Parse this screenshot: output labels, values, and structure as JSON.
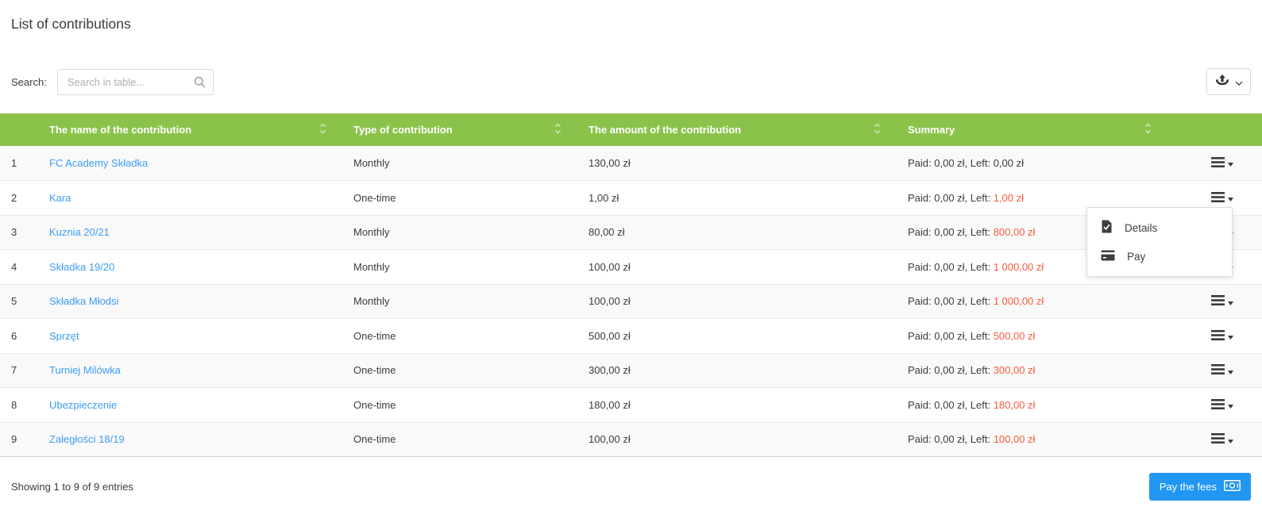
{
  "page_title": "List of contributions",
  "toolbar": {
    "search_label": "Search:",
    "search_placeholder": "Search in table...",
    "export_icon": "export-upload-icon"
  },
  "table": {
    "headers": [
      {
        "label": "The name of the contribution"
      },
      {
        "label": "Type of contribution"
      },
      {
        "label": "The amount of the contribution"
      },
      {
        "label": "Summary"
      }
    ],
    "rows": [
      {
        "index": "1",
        "name": "FC Academy Składka",
        "type": "Monthly",
        "amount": "130,00 zł",
        "summary_prefix": "Paid: 0,00 zł, Left:",
        "summary_left": "0,00 zł",
        "overdue": false
      },
      {
        "index": "2",
        "name": "Kara",
        "type": "One-time",
        "amount": "1,00 zł",
        "summary_prefix": "Paid: 0,00 zł, Left:",
        "summary_left": "1,00 zł",
        "overdue": true
      },
      {
        "index": "3",
        "name": "Kuznia 20/21",
        "type": "Monthly",
        "amount": "80,00 zł",
        "summary_prefix": "Paid: 0,00 zł, Left:",
        "summary_left": "800,00 zł",
        "overdue": true
      },
      {
        "index": "4",
        "name": "Składka 19/20",
        "type": "Monthly",
        "amount": "100,00 zł",
        "summary_prefix": "Paid: 0,00 zł, Left:",
        "summary_left": "1 000,00 zł",
        "overdue": true
      },
      {
        "index": "5",
        "name": "Składka Młodsi",
        "type": "Monthly",
        "amount": "100,00 zł",
        "summary_prefix": "Paid: 0,00 zł, Left:",
        "summary_left": "1 000,00 zł",
        "overdue": true
      },
      {
        "index": "6",
        "name": "Sprzęt",
        "type": "One-time",
        "amount": "500,00 zł",
        "summary_prefix": "Paid: 0,00 zł, Left:",
        "summary_left": "500,00 zł",
        "overdue": true
      },
      {
        "index": "7",
        "name": "Turniej Milówka",
        "type": "One-time",
        "amount": "300,00 zł",
        "summary_prefix": "Paid: 0,00 zł, Left:",
        "summary_left": "300,00 zł",
        "overdue": true
      },
      {
        "index": "8",
        "name": "Ubezpieczenie",
        "type": "One-time",
        "amount": "180,00 zł",
        "summary_prefix": "Paid: 0,00 zł, Left:",
        "summary_left": "180,00 zł",
        "overdue": true
      },
      {
        "index": "9",
        "name": "Zaległości 18/19",
        "type": "One-time",
        "amount": "100,00 zł",
        "summary_prefix": "Paid: 0,00 zł, Left:",
        "summary_left": "100,00 zł",
        "overdue": true
      }
    ]
  },
  "action_menu": {
    "items": [
      {
        "label": "Details",
        "icon": "document-check-icon"
      },
      {
        "label": "Pay",
        "icon": "credit-card-icon"
      }
    ]
  },
  "footer": {
    "showing_text": "Showing 1 to 9 of 9 entries",
    "pay_button_label": "Pay the fees",
    "pay_button_icon": "banknote-icon"
  },
  "colors": {
    "header_green": "#8bc34a",
    "link_blue": "#3d9df3",
    "overdue_red": "#f95b3d",
    "pay_button_blue": "#2196f3"
  }
}
